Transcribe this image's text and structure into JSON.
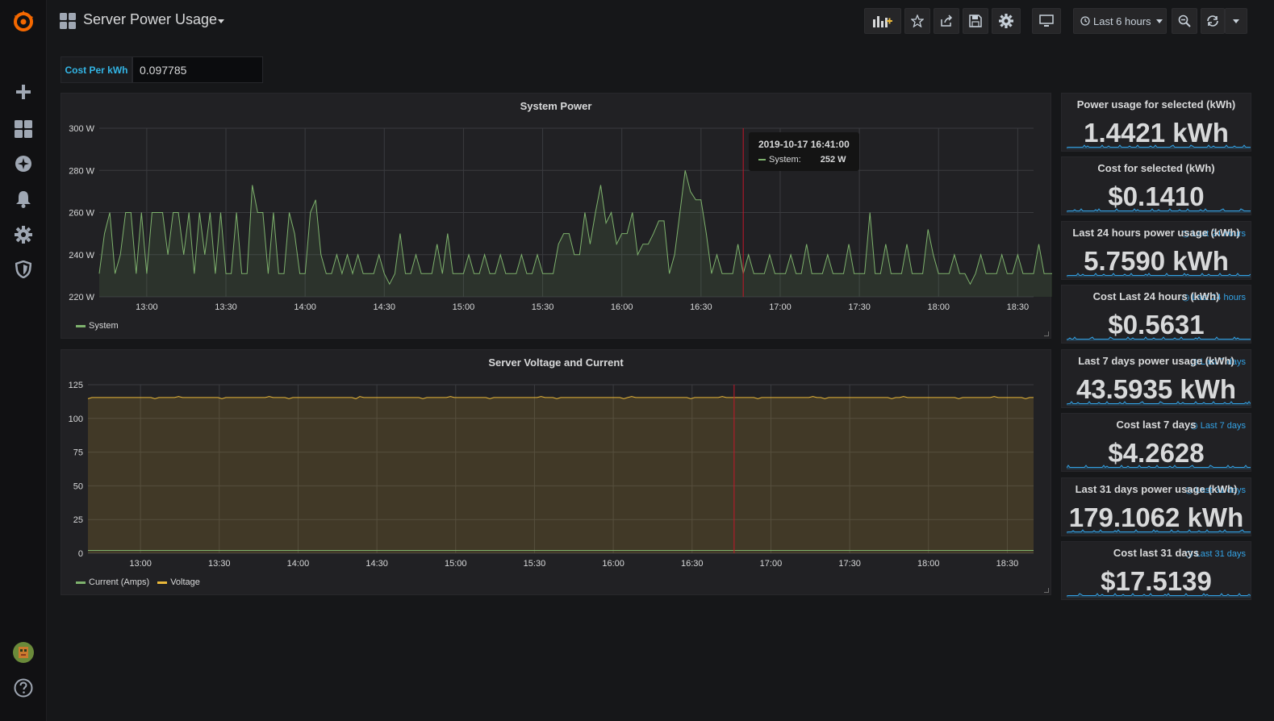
{
  "app": {
    "dashboard_title": "Server Power Usage"
  },
  "toolbar": {
    "time_range": "Last 6 hours",
    "icons": [
      "add-panel-icon",
      "star-icon",
      "share-icon",
      "save-icon",
      "settings-icon",
      "tv-mode-icon",
      "clock-icon",
      "zoom-out-icon",
      "refresh-icon",
      "chevron-down-icon"
    ]
  },
  "sidebar": {
    "icons": [
      "grafana-logo-icon",
      "plus-icon",
      "dashboards-icon",
      "explore-icon",
      "bell-icon",
      "gear-icon",
      "shield-icon",
      "avatar",
      "help-icon"
    ]
  },
  "variable": {
    "label": "Cost Per kWh",
    "value": "0.097785"
  },
  "colors": {
    "green": "#7eb26d",
    "yellow": "#eab839",
    "blue": "#33a2e5",
    "annotation": "#c4162a",
    "orange": "#f46800"
  },
  "panels": {
    "power": {
      "title": "System Power",
      "legend": [
        "System"
      ],
      "tooltip_time": "2019-10-17 16:41:00",
      "tooltip_series": "System:",
      "tooltip_value": "252 W"
    },
    "voltage": {
      "title": "Server Voltage and Current",
      "legend": [
        "Current (Amps)",
        "Voltage"
      ]
    }
  },
  "stats": [
    {
      "title": "Power usage for selected (kWh)",
      "value": "1.4421 kWh",
      "range": ""
    },
    {
      "title": "Cost for selected (kWh)",
      "value": "$0.1410",
      "range": ""
    },
    {
      "title": "Last 24 hours power usage (kWh)",
      "value": "5.7590 kWh",
      "range": "Last 24 hours"
    },
    {
      "title": "Cost Last 24 hours (kWh)",
      "value": "$0.5631",
      "range": "Last 24 hours"
    },
    {
      "title": "Last 7 days power usage (kWh)",
      "value": "43.5935 kWh",
      "range": "Last 7 days"
    },
    {
      "title": "Cost last 7 days",
      "value": "$4.2628",
      "range": "Last 7 days"
    },
    {
      "title": "Last 31 days power usage (kWh)",
      "value": "179.1062 kWh",
      "range": "Last 31 days"
    },
    {
      "title": "Cost last 31 days",
      "value": "$17.5139",
      "range": "Last 31 days"
    }
  ],
  "chart_data": [
    {
      "type": "line",
      "title": "System Power",
      "xlabel": "",
      "ylabel": "",
      "x_ticks": [
        "13:00",
        "13:30",
        "14:00",
        "14:30",
        "15:00",
        "15:30",
        "16:00",
        "16:30",
        "17:00",
        "17:30",
        "18:00",
        "18:30"
      ],
      "y_ticks": [
        "220 W",
        "240 W",
        "260 W",
        "280 W",
        "300 W"
      ],
      "ylim": [
        220,
        300
      ],
      "x_range": [
        "12:42",
        "18:36"
      ],
      "grid": true,
      "legend": "bottom-left",
      "annotation_time": "16:46",
      "series": [
        {
          "name": "System",
          "sample_minutes": 2,
          "start": "12:42",
          "values": [
            231,
            250,
            260,
            231,
            240,
            260,
            260,
            231,
            260,
            231,
            260,
            260,
            260,
            240,
            260,
            260,
            240,
            260,
            231,
            260,
            240,
            260,
            231,
            260,
            231,
            231,
            260,
            231,
            231,
            273,
            260,
            260,
            231,
            260,
            231,
            231,
            260,
            250,
            231,
            231,
            260,
            266,
            240,
            231,
            231,
            240,
            231,
            240,
            231,
            240,
            231,
            231,
            231,
            240,
            231,
            226,
            231,
            250,
            231,
            231,
            240,
            231,
            231,
            231,
            245,
            231,
            250,
            231,
            231,
            231,
            240,
            231,
            231,
            240,
            231,
            231,
            240,
            231,
            231,
            231,
            240,
            231,
            231,
            240,
            231,
            231,
            231,
            245,
            250,
            250,
            240,
            240,
            260,
            245,
            260,
            273,
            255,
            260,
            245,
            250,
            250,
            260,
            240,
            245,
            245,
            250,
            256,
            256,
            231,
            240,
            260,
            280,
            270,
            266,
            266,
            250,
            231,
            240,
            231,
            231,
            231,
            245,
            231,
            240,
            231,
            231,
            231,
            240,
            231,
            231,
            231,
            240,
            231,
            231,
            245,
            231,
            231,
            231,
            240,
            231,
            231,
            231,
            245,
            231,
            231,
            231,
            260,
            231,
            231,
            245,
            231,
            231,
            231,
            245,
            231,
            231,
            231,
            252,
            240,
            231,
            231,
            231,
            240,
            231,
            231,
            226,
            231,
            240,
            231,
            231,
            231,
            240,
            231,
            231,
            240,
            231,
            231,
            231,
            245,
            231,
            231,
            231,
            240,
            240,
            231,
            231,
            231,
            245,
            231,
            231,
            231,
            260,
            231,
            231,
            240,
            231,
            231,
            231,
            240,
            231,
            231,
            231,
            240,
            231,
            231,
            231,
            245,
            231,
            231,
            231,
            245,
            231,
            231,
            240,
            231,
            231,
            231,
            240,
            231,
            231,
            231,
            240,
            231,
            231,
            231,
            260,
            231
          ]
        }
      ]
    },
    {
      "type": "line",
      "title": "Server Voltage and Current",
      "xlabel": "",
      "ylabel": "",
      "x_ticks": [
        "13:00",
        "13:30",
        "14:00",
        "14:30",
        "15:00",
        "15:30",
        "16:00",
        "16:30",
        "17:00",
        "17:30",
        "18:00",
        "18:30"
      ],
      "y_ticks": [
        "0",
        "25",
        "50",
        "75",
        "100",
        "125"
      ],
      "ylim": [
        0,
        125
      ],
      "x_range": [
        "12:40",
        "18:40"
      ],
      "grid": true,
      "legend": "bottom-left",
      "annotation_time": "16:46",
      "series": [
        {
          "name": "Current (Amps)",
          "constant": 2.1
        },
        {
          "name": "Voltage",
          "constant": 115.5
        }
      ]
    }
  ]
}
